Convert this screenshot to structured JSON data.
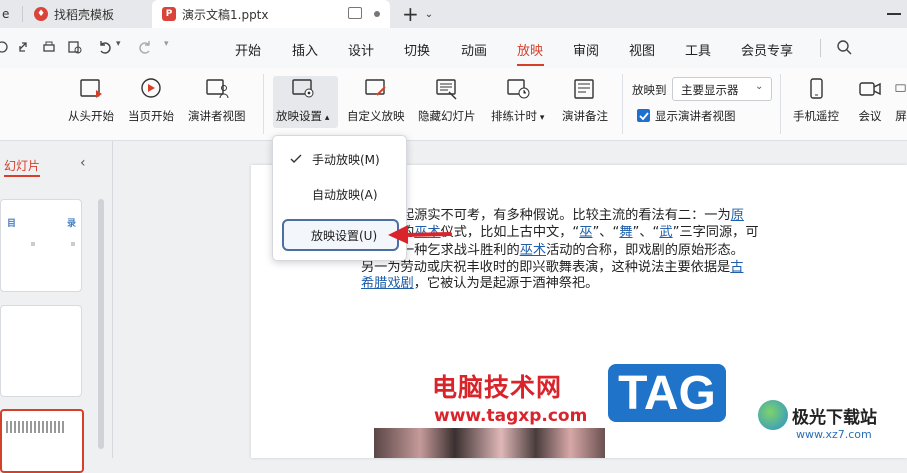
{
  "tabs": {
    "partial_tab": "e",
    "tab1_label": "找稻壳模板",
    "tab2_label": "演示文稿1.pptx",
    "tab2_icon_letter": "P",
    "new_tab_symbol": "+"
  },
  "menu": {
    "items": [
      "开始",
      "插入",
      "设计",
      "切换",
      "动画",
      "放映",
      "审阅",
      "视图",
      "工具",
      "会员专享"
    ],
    "active": "放映"
  },
  "ribbon": {
    "buttons": [
      "从头开始",
      "当页开始",
      "演讲者视图",
      "放映设置",
      "自定义放映",
      "隐藏幻灯片",
      "排练计时",
      "演讲备注",
      "手机遥控",
      "会议",
      "屏"
    ],
    "show_to_label": "放映到",
    "monitor_select_value": "主要显示器",
    "presenter_view_checkbox_label": "显示演讲者视图",
    "presenter_view_checked": true
  },
  "sidebar": {
    "title": "幻灯片",
    "thumb1_text_left": "目",
    "thumb1_text_right": "录"
  },
  "dropdown": {
    "items": [
      "手动放映(M)",
      "自动放映(A)",
      "放映设置(U)"
    ],
    "checked_index": 0,
    "highlighted_index": 2
  },
  "slide": {
    "line1_a": "起源实不可考，有多种假说。比较主流的看法有二：一为",
    "line1_link": "原",
    "line2_a": "的",
    "line2_link1": "巫术",
    "line2_b": "仪式，比如上古中文，“",
    "line2_link2": "巫",
    "line2_c": "”、“",
    "line2_link3": "舞",
    "line2_d": "”、“",
    "line2_link4": "武",
    "line2_e": "”三字同源，可",
    "line3_a": "一种乞求战斗胜利的",
    "line3_link": "巫术",
    "line3_b": "活动的合称，即戏剧的原始形态。",
    "line4_a": "另一为劳动或庆祝丰收时的即兴歌舞表演，这种说法主要依据是",
    "line4_link": "古",
    "line5_link": "希腊戏剧",
    "line5_b": "，它被认为是起源于酒神祭祀。"
  },
  "watermark": {
    "site_name": "电脑技术网",
    "site_url": "www.tagxp.com",
    "badge": "TAG",
    "corner_name": "极光下载站",
    "corner_url": "www.xz7.com"
  },
  "colors": {
    "accent": "#d6402b",
    "link": "#1f5ea8",
    "highlight_border": "#4a6fa5",
    "arrow": "#d9242b",
    "tag_blue": "#1f73c9"
  }
}
